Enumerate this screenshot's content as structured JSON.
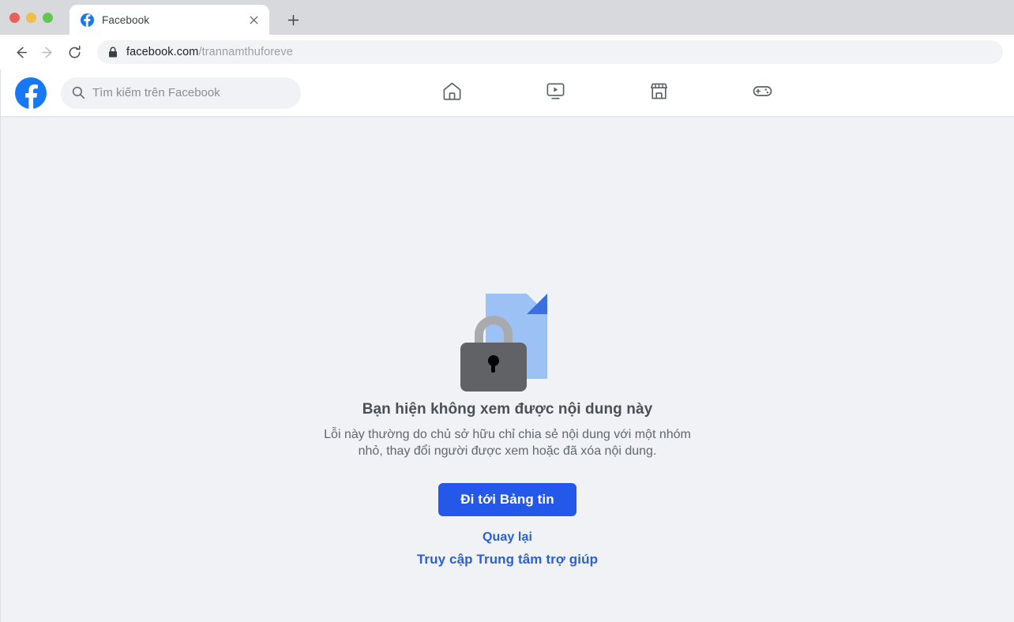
{
  "browser": {
    "window_controls": [
      "close",
      "minimize",
      "zoom"
    ],
    "tab": {
      "title": "Facebook",
      "favicon": "facebook-icon",
      "close_label": "×"
    },
    "new_tab_label": "+",
    "back_icon": "arrow-left-icon",
    "forward_icon": "arrow-right-icon",
    "reload_icon": "reload-icon",
    "address_bar": {
      "lock_icon": "lock-icon",
      "host": "facebook.com",
      "path": "/trannamthuforeve"
    }
  },
  "facebook": {
    "logo": "facebook-logo",
    "search": {
      "icon": "search-icon",
      "placeholder": "Tìm kiếm trên Facebook",
      "value": ""
    },
    "nav": [
      {
        "name": "home",
        "icon": "home-icon"
      },
      {
        "name": "watch",
        "icon": "video-icon"
      },
      {
        "name": "marketplace",
        "icon": "store-icon"
      },
      {
        "name": "gaming",
        "icon": "gamepad-icon"
      }
    ]
  },
  "error_page": {
    "illustration": "locked-document-icon",
    "title": "Bạn hiện không xem được nội dung này",
    "body": "Lỗi này thường do chủ sở hữu chỉ chia sẻ nội dung với một nhóm nhỏ, thay đổi người được xem hoặc đã xóa nội dung.",
    "primary_button": "Đi tới Bảng tin",
    "back_link": "Quay lại",
    "help_link": "Truy cập Trung tâm trợ giúp"
  },
  "colors": {
    "facebook_blue": "#1877f2",
    "button_blue": "#2458e8",
    "link_blue": "#2b60d8",
    "page_background": "#f0f2f5",
    "doc_blue": "#9cc2f5",
    "doc_fold_blue": "#3b6fe0",
    "lock_gray": "#606265",
    "shackle_gray": "#a8aaad"
  }
}
